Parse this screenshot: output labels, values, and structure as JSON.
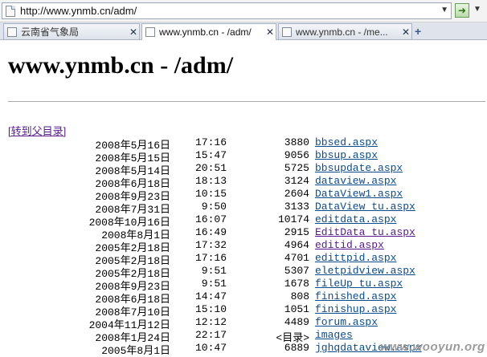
{
  "browser": {
    "address": "http://www.ynmb.cn/adm/",
    "tabs": [
      {
        "label": "云南省气象局",
        "active": false
      },
      {
        "label": "www.ynmb.cn - /adm/",
        "active": true
      },
      {
        "label": "www.ynmb.cn - /me...",
        "active": false
      }
    ],
    "new_tab": "+",
    "close": "✕",
    "go": "➜",
    "dropdown": "▼"
  },
  "page": {
    "title": "www.ynmb.cn - /adm/",
    "parent_link": "[转到父目录]",
    "entries": [
      {
        "date": "2008年5月16日",
        "time": "17:16",
        "size": "3880",
        "name": "bbsed.aspx",
        "visited": false
      },
      {
        "date": "2008年5月15日",
        "time": "15:47",
        "size": "9056",
        "name": "bbsup.aspx",
        "visited": false
      },
      {
        "date": "2008年5月14日",
        "time": "20:51",
        "size": "5725",
        "name": "bbsupdate.aspx",
        "visited": false
      },
      {
        "date": "2008年6月18日",
        "time": "18:13",
        "size": "3124",
        "name": "dataview.aspx",
        "visited": false
      },
      {
        "date": "2008年9月23日",
        "time": "10:15",
        "size": "2604",
        "name": "DataView1.aspx",
        "visited": false
      },
      {
        "date": "2008年7月31日",
        "time": "9:50",
        "size": "3133",
        "name": "DataView_tu.aspx",
        "visited": false
      },
      {
        "date": "2008年10月16日",
        "time": "16:07",
        "size": "10174",
        "name": "editdata.aspx",
        "visited": false
      },
      {
        "date": "2008年8月1日",
        "time": "16:49",
        "size": "2915",
        "name": "EditData_tu.aspx",
        "visited": true
      },
      {
        "date": "2005年2月18日",
        "time": "17:32",
        "size": "4964",
        "name": "editid.aspx",
        "visited": true
      },
      {
        "date": "2005年2月18日",
        "time": "17:16",
        "size": "4701",
        "name": "edittpid.aspx",
        "visited": false
      },
      {
        "date": "2005年2月18日",
        "time": "9:51",
        "size": "5307",
        "name": "eletpidview.aspx",
        "visited": false
      },
      {
        "date": "2008年9月23日",
        "time": "9:51",
        "size": "1678",
        "name": "fileUp_tu.aspx",
        "visited": false
      },
      {
        "date": "2008年6月18日",
        "time": "14:47",
        "size": "808",
        "name": "finished.aspx",
        "visited": false
      },
      {
        "date": "2008年7月10日",
        "time": "15:10",
        "size": "1051",
        "name": "finishup.aspx",
        "visited": false
      },
      {
        "date": "2004年11月12日",
        "time": "12:12",
        "size": "4489",
        "name": "forum.aspx",
        "visited": false
      },
      {
        "date": "2008年1月24日",
        "time": "22:17",
        "size": "<目录>",
        "name": "images",
        "visited": false
      },
      {
        "date": "2005年8月1日",
        "time": "10:47",
        "size": "6889",
        "name": "jghqdataview.aspx",
        "visited": false
      }
    ],
    "watermark": "www.wooyun.org"
  },
  "colors": {
    "link": "#0b4b8c",
    "visited": "#551a8b"
  }
}
